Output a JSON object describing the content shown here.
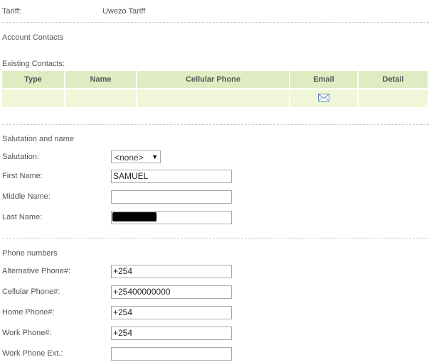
{
  "tariff": {
    "label": "Tariff:",
    "value": "Uwezo Tariff"
  },
  "account_contacts": {
    "title": "Account Contacts",
    "existing_label": "Existing Contacts:",
    "columns": [
      "Type",
      "Name",
      "Cellular Phone",
      "Email",
      "Detail"
    ],
    "email_icon": "envelope-icon"
  },
  "salutation_section": {
    "title": "Salutation and name",
    "salutation": {
      "label": "Salutation:",
      "selected": "<none>"
    },
    "first_name": {
      "label": "First Name:",
      "value": "SAMUEL"
    },
    "middle_name": {
      "label": "Middle Name:",
      "value": ""
    },
    "last_name": {
      "label": "Last Name:",
      "value": ""
    }
  },
  "phone_section": {
    "title": "Phone numbers",
    "alternative": {
      "label": "Alternative Phone#:",
      "value": "+254"
    },
    "cellular": {
      "label": "Cellular Phone#:",
      "value": "+25400000000"
    },
    "home": {
      "label": "Home Phone#:",
      "value": "+254"
    },
    "work": {
      "label": "Work Phone#:",
      "value": "+254"
    },
    "work_ext": {
      "label": "Work Phone Ext.:",
      "value": ""
    }
  },
  "colors": {
    "table_header": "#e0ebc2",
    "table_row": "#f0f7d9",
    "separator": "#c8c8c8"
  }
}
